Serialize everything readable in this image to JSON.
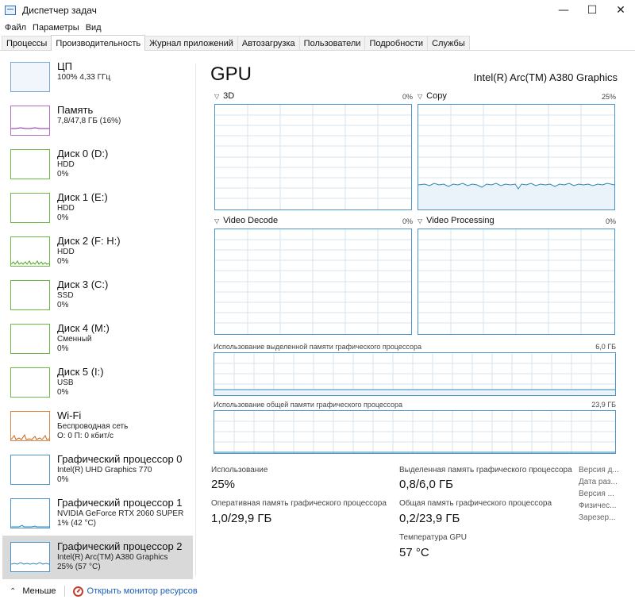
{
  "window": {
    "title": "Диспетчер задач",
    "minimize": "—",
    "maximize": "☐",
    "close": "✕"
  },
  "menu": [
    "Файл",
    "Параметры",
    "Вид"
  ],
  "tabs": [
    "Процессы",
    "Производительность",
    "Журнал приложений",
    "Автозагрузка",
    "Пользователи",
    "Подробности",
    "Службы"
  ],
  "sidebar": {
    "items": [
      {
        "name": "ЦП",
        "sub1": "100% 4,33 ГГц",
        "sub2": "",
        "color": "#2d6fb8"
      },
      {
        "name": "Память",
        "sub1": "7,8/47,8 ГБ (16%)",
        "sub2": "",
        "color": "#8b26a8"
      },
      {
        "name": "Диск 0 (D:)",
        "sub1": "HDD",
        "sub2": "0%",
        "color": "#4fa628"
      },
      {
        "name": "Диск 1 (E:)",
        "sub1": "HDD",
        "sub2": "0%",
        "color": "#4fa628"
      },
      {
        "name": "Диск 2 (F: H:)",
        "sub1": "HDD",
        "sub2": "0%",
        "color": "#4fa628"
      },
      {
        "name": "Диск 3 (C:)",
        "sub1": "SSD",
        "sub2": "0%",
        "color": "#4fa628"
      },
      {
        "name": "Диск 4 (M:)",
        "sub1": "Сменный",
        "sub2": "0%",
        "color": "#4fa628"
      },
      {
        "name": "Диск 5 (I:)",
        "sub1": "USB",
        "sub2": "0%",
        "color": "#4fa628"
      },
      {
        "name": "Wi-Fi",
        "sub1": "Беспроводная сеть",
        "sub2": "О: 0 П: 0 кбит/с",
        "color": "#c7671c"
      },
      {
        "name": "Графический процессор 0",
        "sub1": "Intel(R) UHD Graphics 770",
        "sub2": "0%",
        "color": "#2d87b8"
      },
      {
        "name": "Графический процессор 1",
        "sub1": "NVIDIA GeForce RTX 2060 SUPER",
        "sub2": "1% (42 °C)",
        "color": "#2d87b8"
      },
      {
        "name": "Графический процессор 2",
        "sub1": "Intel(R) Arc(TM) A380 Graphics",
        "sub2": "25% (57 °C)",
        "color": "#2d87b8"
      }
    ]
  },
  "main": {
    "title": "GPU",
    "model": "Intel(R) Arc(TM) A380 Graphics",
    "graphs": [
      {
        "label": "3D",
        "percent": "0%"
      },
      {
        "label": "Copy",
        "percent": "25%"
      },
      {
        "label": "Video Decode",
        "percent": "0%"
      },
      {
        "label": "Video Processing",
        "percent": "0%"
      }
    ],
    "dedicated_memory": {
      "label": "Использование выделенной памяти графического процессора",
      "max": "6,0 ГБ"
    },
    "shared_memory": {
      "label": "Использование общей памяти графического процессора",
      "max": "23,9 ГБ"
    },
    "stats": {
      "usage_label": "Использование",
      "usage_value": "25%",
      "gpu_ram_label": "Оперативная память графического процессора",
      "gpu_ram_value": "1,0/29,9 ГБ",
      "dedicated_label": "Выделенная память графического процессора",
      "dedicated_value": "0,8/6,0 ГБ",
      "shared_label": "Общая память графического процессора",
      "shared_value": "0,2/23,9 ГБ",
      "temp_label": "Температура GPU",
      "temp_value": "57 °C"
    },
    "right_labels": [
      "Версия д...",
      "Дата раз...",
      "Версия ...",
      "Физичес...",
      "Зарезер..."
    ]
  },
  "footer": {
    "fewer": "Меньше",
    "monitor_link": "Открыть монитор ресурсов"
  }
}
